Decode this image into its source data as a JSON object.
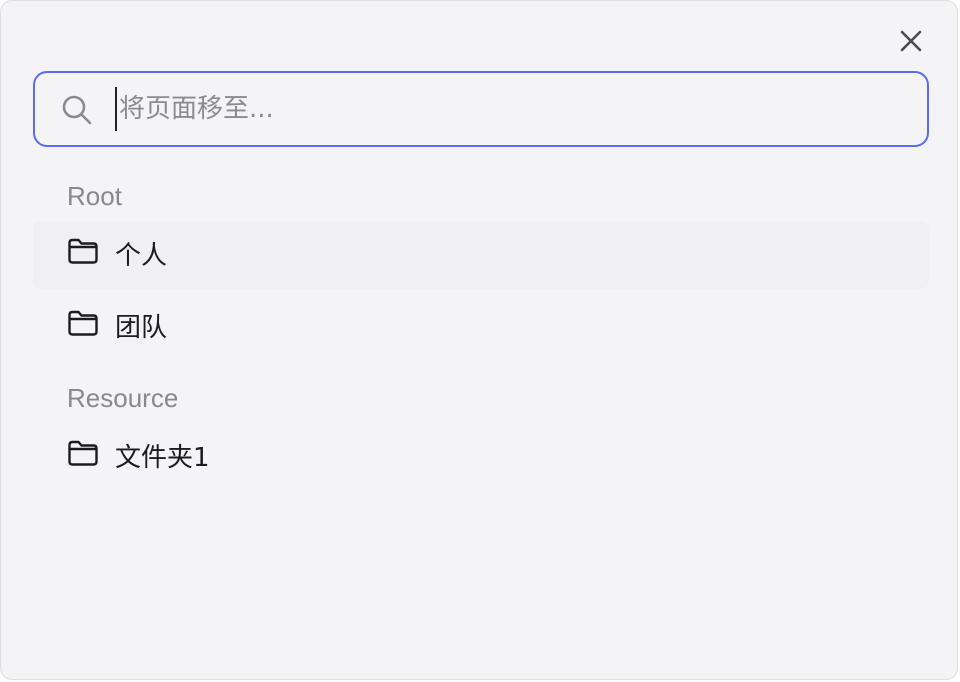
{
  "search": {
    "placeholder": "将页面移至...",
    "value": ""
  },
  "sections": [
    {
      "label": "Root",
      "items": [
        {
          "label": "个人",
          "icon": "folder-icon",
          "highlighted": true
        },
        {
          "label": "团队",
          "icon": "folder-icon",
          "highlighted": false
        }
      ]
    },
    {
      "label": "Resource",
      "items": [
        {
          "label": "文件夹1",
          "icon": "folder-icon",
          "highlighted": false
        }
      ]
    }
  ],
  "colors": {
    "accent": "#5b6cf2",
    "background": "#f4f4f7",
    "section_label": "#88888e",
    "text": "#1c1c1e"
  }
}
